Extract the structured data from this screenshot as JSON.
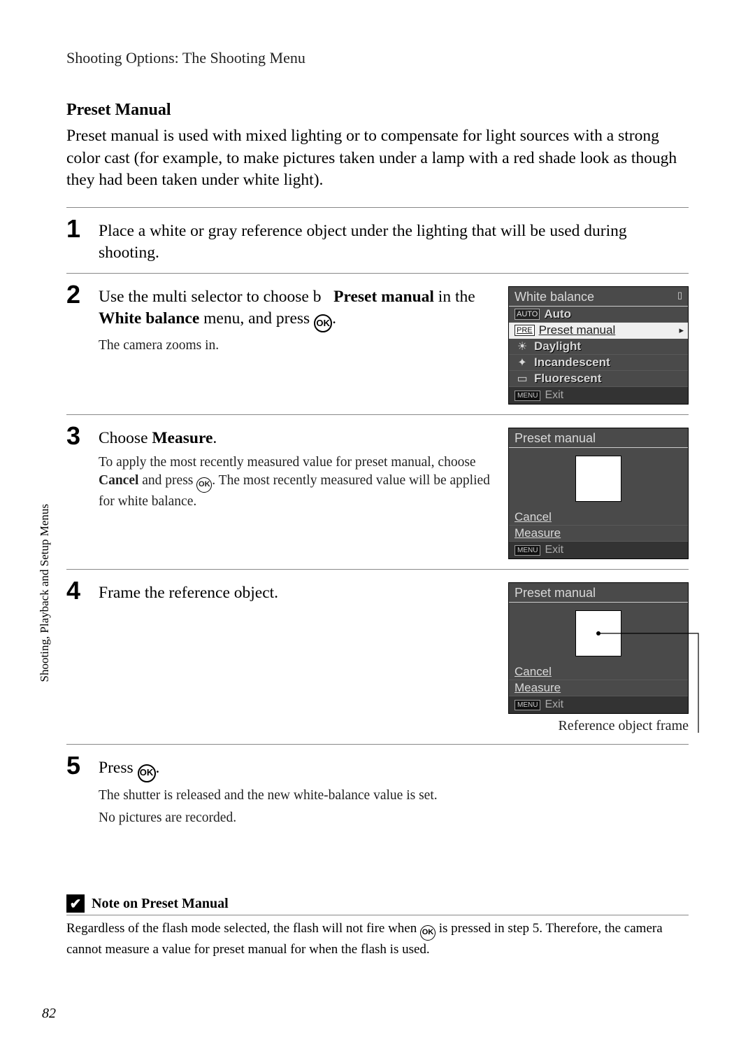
{
  "header": "Shooting Options: The Shooting Menu",
  "section_title": "Preset Manual",
  "intro": "Preset manual is used with mixed lighting or to compensate for light sources with a strong color cast (for example, to make pictures taken under a lamp with a red shade look as though they had been taken under white light).",
  "steps": {
    "s1": {
      "num": "1",
      "text": "Place a white or gray reference object under the lighting that will be used during shooting."
    },
    "s2": {
      "num": "2",
      "text_a": "Use the multi selector to choose b",
      "text_b": "Preset manual",
      "text_c": " in the ",
      "text_d": "White balance",
      "text_e": " menu, and press ",
      "sub": "The camera zooms in."
    },
    "s3": {
      "num": "3",
      "text_a": "Choose ",
      "text_b": "Measure",
      "text_c": ".",
      "sub_a": "To apply the most recently measured value for preset manual, choose ",
      "sub_b": "Cancel",
      "sub_c": " and press ",
      "sub_d": ". The most recently measured value will be applied for white balance."
    },
    "s4": {
      "num": "4",
      "text": "Frame the reference object.",
      "caption": "Reference object frame"
    },
    "s5": {
      "num": "5",
      "text_a": "Press ",
      "text_b": ".",
      "sub1": "The shutter is released and the new white-balance value is set.",
      "sub2": "No pictures are recorded."
    }
  },
  "lcd1": {
    "title": "White balance",
    "items": {
      "auto": {
        "badge": "AUTO",
        "label": "Auto"
      },
      "preset": {
        "badge": "PRE",
        "label": "Preset manual"
      },
      "daylight": {
        "label": "Daylight"
      },
      "incandescent": {
        "label": "Incandescent"
      },
      "fluorescent": {
        "label": "Fluorescent"
      }
    },
    "exit": "Exit",
    "menu_badge": "MENU"
  },
  "lcd2": {
    "title": "Preset manual",
    "cancel": "Cancel",
    "measure": "Measure",
    "exit": "Exit",
    "menu_badge": "MENU"
  },
  "lcd3": {
    "title": "Preset manual",
    "cancel": "Cancel",
    "measure": "Measure",
    "exit": "Exit",
    "menu_badge": "MENU"
  },
  "ok_label": "OK",
  "note": {
    "title": "Note on Preset Manual",
    "body_a": "Regardless of the flash mode selected, the flash will not fire when ",
    "body_b": " is pressed in step 5. Therefore, the camera cannot measure a value for preset manual for when the flash is used."
  },
  "side_text": "Shooting, Playback and Setup Menus",
  "page_num": "82"
}
